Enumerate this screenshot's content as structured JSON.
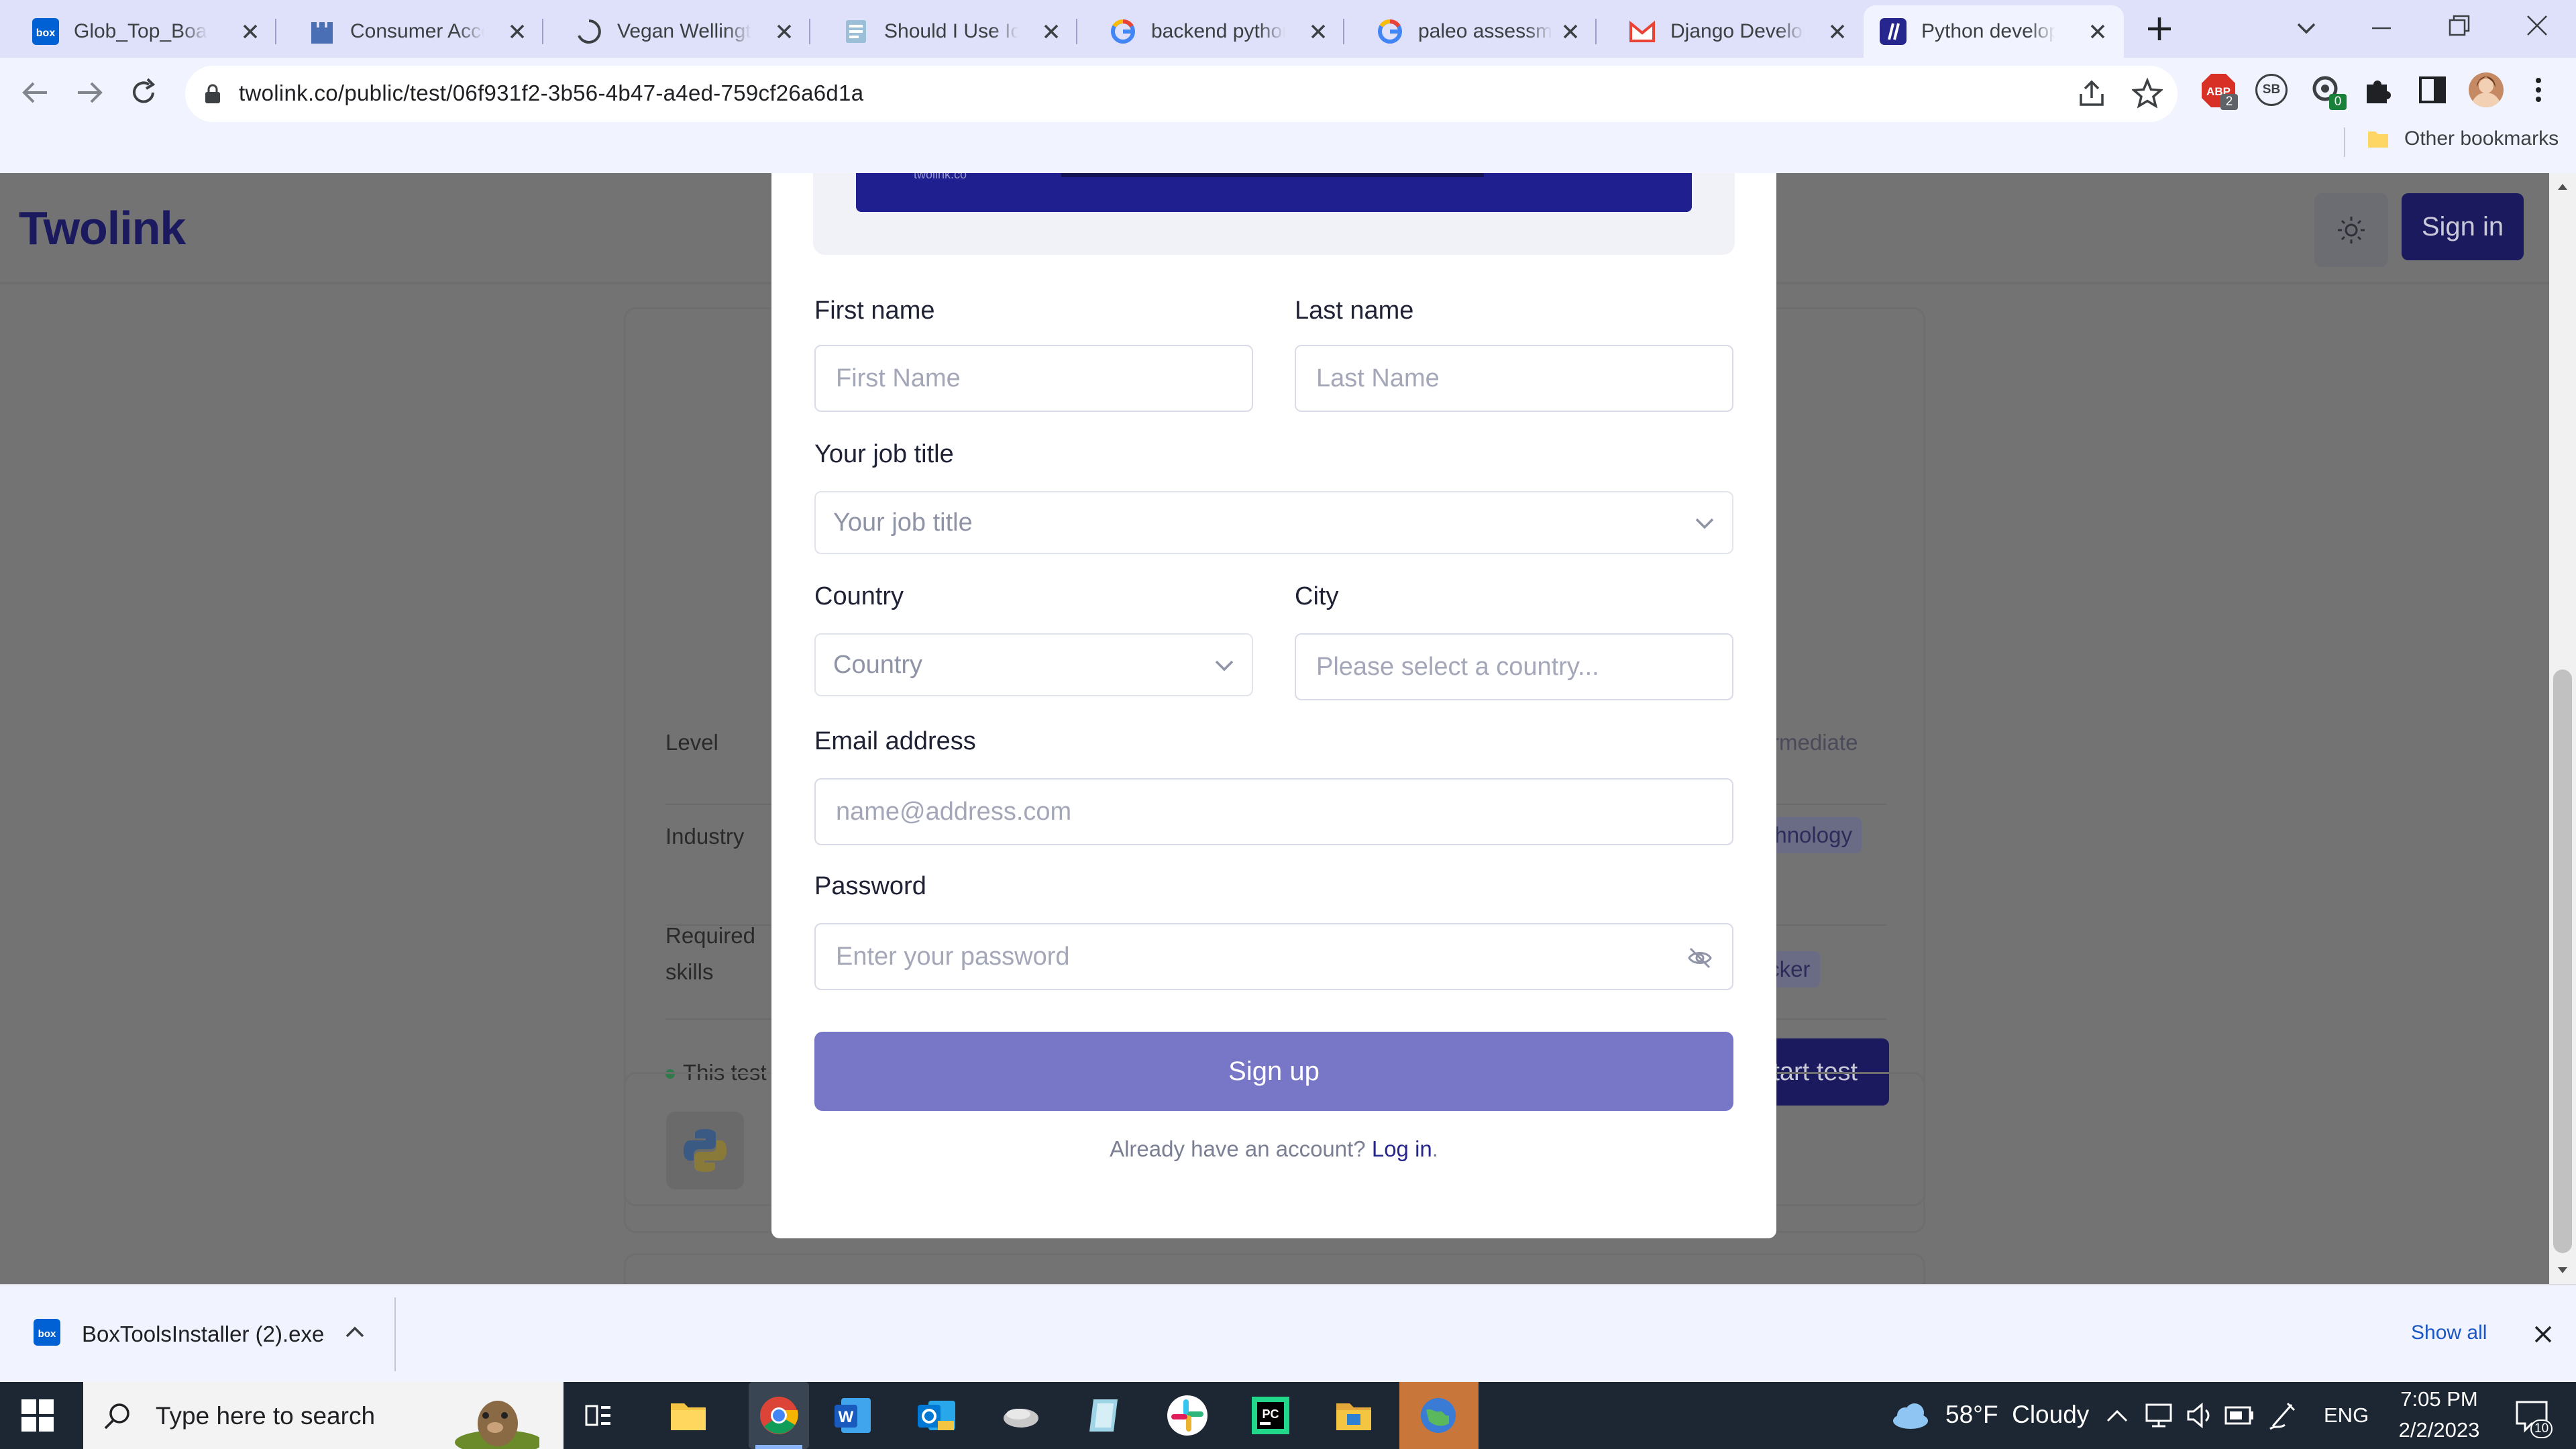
{
  "browser": {
    "tabs": [
      {
        "title": "Glob_Top_Board_",
        "favicon": "box-icon"
      },
      {
        "title": "Consumer Account",
        "favicon": "castle-icon"
      },
      {
        "title": "Vegan Wellington",
        "favicon": "spinner-icon"
      },
      {
        "title": "Should I Use Ice or",
        "favicon": "page-icon"
      },
      {
        "title": "backend python d",
        "favicon": "google-icon"
      },
      {
        "title": "paleo assessment",
        "favicon": "google-icon"
      },
      {
        "title": "Django Developer",
        "favicon": "gmail-icon"
      },
      {
        "title": "Python developer",
        "favicon": "twolink-icon",
        "active": true
      }
    ],
    "url": "twolink.co/public/test/06f931f2-3b56-4b47-a4ed-759cf26a6d1a",
    "bookmarks": {
      "other": "Other bookmarks"
    },
    "extension_badges": {
      "abp": "ABP",
      "abp_count": "2",
      "sb": "SB",
      "ext_count": "0"
    }
  },
  "site": {
    "logo": "Twolink",
    "sign_in": "Sign in",
    "details": {
      "level_label": "Level",
      "level_value": "Intermediate",
      "industry_label": "Industry",
      "industry_value": "Technology",
      "skills_label": "Required skills",
      "skills_value": "Docker",
      "note": "This test",
      "start_button": "Start test"
    }
  },
  "modal": {
    "first_name": {
      "label": "First name",
      "placeholder": "First Name"
    },
    "last_name": {
      "label": "Last name",
      "placeholder": "Last Name"
    },
    "job_title": {
      "label": "Your job title",
      "placeholder": "Your job title"
    },
    "country": {
      "label": "Country",
      "placeholder": "Country"
    },
    "city": {
      "label": "City",
      "placeholder": "Please select a country..."
    },
    "email": {
      "label": "Email address",
      "placeholder": "name@address.com"
    },
    "password": {
      "label": "Password",
      "placeholder": "Enter your password"
    },
    "signup_button": "Sign up",
    "login_prompt": "Already have an account?",
    "login_link": "Log in",
    "login_period": ".",
    "banner_text": "twolink.co"
  },
  "downloads": {
    "file": "BoxToolsInstaller (2).exe",
    "show_all": "Show all"
  },
  "taskbar": {
    "search_placeholder": "Type here to search",
    "weather": "58°F  Cloudy",
    "lang": "ENG",
    "time": "7:05 PM",
    "date": "2/2/2023",
    "notification_count": "10"
  },
  "colors": {
    "brand": "#27268f",
    "signup": "#7877c7",
    "overlay": "#737373"
  }
}
